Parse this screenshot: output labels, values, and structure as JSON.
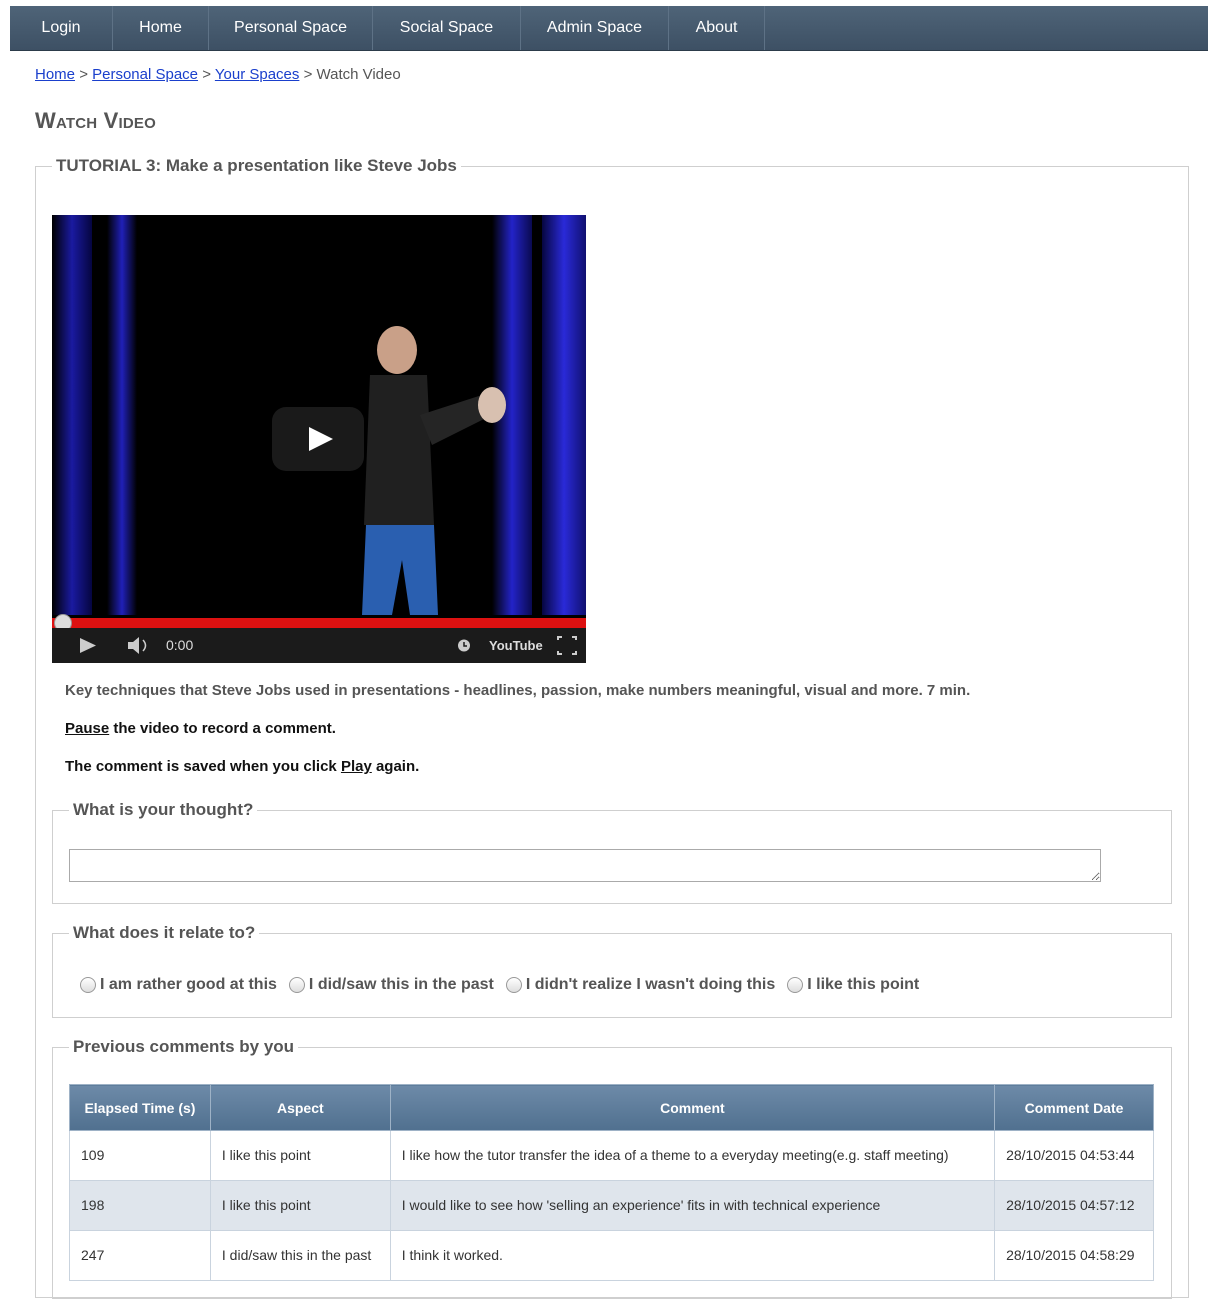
{
  "nav": {
    "items": [
      "Login",
      "Home",
      "Personal Space",
      "Social Space",
      "Admin Space",
      "About"
    ]
  },
  "breadcrumb": {
    "home": "Home",
    "personal_space": "Personal Space",
    "your_spaces": "Your Spaces",
    "current": "Watch Video",
    "separator": ">"
  },
  "page_title": "Watch Video",
  "tutorial": {
    "legend": "TUTORIAL 3: Make a presentation like Steve Jobs",
    "video": {
      "time": "0:00",
      "brand": "YouTube",
      "progress": 0
    },
    "description": "Key techniques that Steve Jobs used in presentations - headlines, passion, make numbers meaningful, visual and more. 7 min.",
    "instruction1": {
      "link": "Pause",
      "text": " the video to record a comment."
    },
    "instruction2": {
      "text": "The comment is saved when you click ",
      "link": "Play",
      "suffix": " again."
    }
  },
  "thought": {
    "legend": "What is your thought?",
    "value": ""
  },
  "relate": {
    "legend": "What does it relate to?",
    "options": [
      "I am rather good at this",
      "I did/saw this in the past",
      "I didn't realize I wasn't doing this",
      "I like this point"
    ]
  },
  "previous": {
    "legend": "Previous comments by you",
    "columns": [
      "Elapsed Time (s)",
      "Aspect",
      "Comment",
      "Comment Date"
    ],
    "rows": [
      {
        "elapsed": "109",
        "aspect": "I like this point",
        "comment": "I like how the tutor transfer the idea of a theme to a everyday meeting(e.g. staff meeting)",
        "date": "28/10/2015 04:53:44"
      },
      {
        "elapsed": "198",
        "aspect": "I like this point",
        "comment": "I would like to see how 'selling an experience' fits in with technical experience",
        "date": "28/10/2015 04:57:12"
      },
      {
        "elapsed": "247",
        "aspect": "I did/saw this in the past",
        "comment": "I think it worked.",
        "date": "28/10/2015 04:58:29"
      }
    ]
  },
  "colors": {
    "nav_bg": "#4a5e72",
    "link": "#1a3fcc",
    "table_header": "#5f7d9c",
    "progress": "#dd1111"
  }
}
